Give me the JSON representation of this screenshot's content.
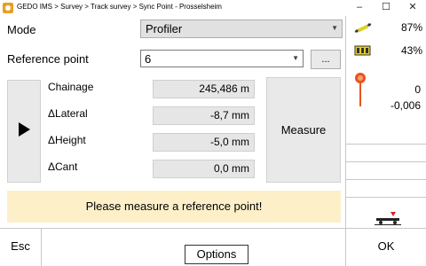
{
  "window": {
    "title": "GEDO IMS > Survey > Track survey > Sync Point - Prosselsheim",
    "minimize": "–",
    "maximize": "☐",
    "close": "✕"
  },
  "form": {
    "mode_label": "Mode",
    "mode_value": "Profiler",
    "reference_label": "Reference point",
    "reference_value": "6",
    "browse_label": "...",
    "dropdown_arrow": "▼"
  },
  "measurements": [
    {
      "label": "Chainage",
      "value": "245,486 m"
    },
    {
      "label": "ΔLateral",
      "value": "-8,7 mm"
    },
    {
      "label": "ΔHeight",
      "value": "-5,0 mm"
    },
    {
      "label": "ΔCant",
      "value": "0,0 mm"
    }
  ],
  "measure_button": "Measure",
  "message": "Please measure a reference point!",
  "status": {
    "wifi_percent": "87%",
    "battery_percent": "43%",
    "value_1": "0",
    "value_2": "-0,006",
    "colors": {
      "accent": "#e8a020",
      "pin": "#e8541e",
      "trolley_marker": "#e02020"
    }
  },
  "footer": {
    "esc": "Esc",
    "options": "Options",
    "ok": "OK"
  }
}
